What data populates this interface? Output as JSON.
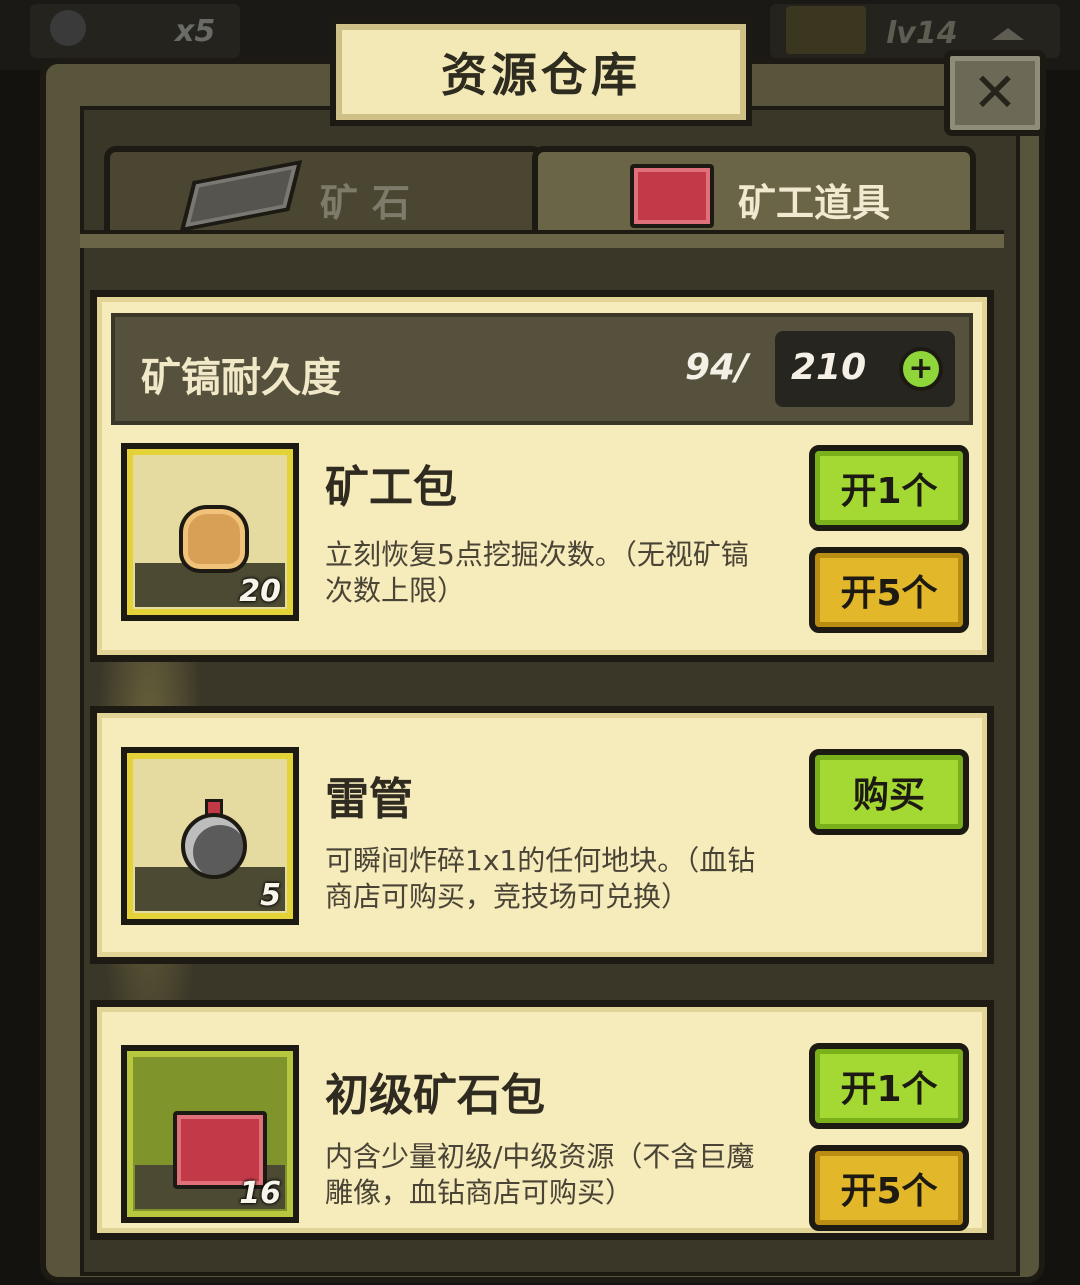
{
  "hud": {
    "bomb_count": "x5",
    "level": "lv14"
  },
  "window": {
    "title": "资源仓库",
    "close_label": "✕"
  },
  "tabs": [
    {
      "label": "矿石",
      "icon": "ingot-icon",
      "active": false
    },
    {
      "label": "矿工道具",
      "icon": "crate-icon",
      "active": true
    }
  ],
  "durability": {
    "label": "矿镐耐久度",
    "current": "94/",
    "max": "210",
    "add_label": "+"
  },
  "items": [
    {
      "name": "矿工包",
      "description": "立刻恢复5点挖掘次数。（无视矿镐次数上限）",
      "count": "20",
      "icon": "sack-icon",
      "buttons": [
        "开1个",
        "开5个"
      ]
    },
    {
      "name": "雷管",
      "description": "可瞬间炸碎1x1的任何地块。（血钻商店可购买，竞技场可兑换）",
      "count": "5",
      "icon": "bomb-icon",
      "buttons": [
        "购买"
      ]
    },
    {
      "name": "初级矿石包",
      "description": "内含少量初级/中级资源（不含巨魔雕像，血钻商店可购买）",
      "count": "16",
      "icon": "crate-icon",
      "buttons": [
        "开1个",
        "开5个"
      ]
    }
  ],
  "colors": {
    "button_green": "#a4d832",
    "button_gold": "#e2b72a",
    "card_bg": "#f6ebbb",
    "frame": "#59553d"
  }
}
